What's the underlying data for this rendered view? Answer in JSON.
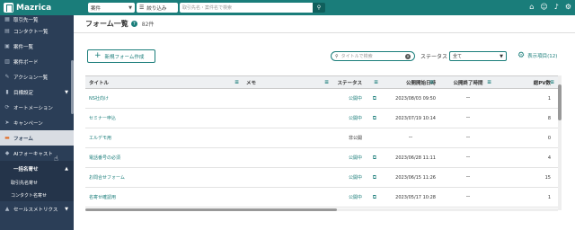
{
  "app": {
    "name": "Mazrica"
  },
  "topbar": {
    "search_type": "案件",
    "filter_label": "絞り込み",
    "search_placeholder": "取引先名・案件名で検索"
  },
  "sidebar": {
    "items": [
      {
        "label": "取引先一覧",
        "icon": "building-icon"
      },
      {
        "label": "コンタクト一覧",
        "icon": "contact-card-icon"
      },
      {
        "label": "案件一覧",
        "icon": "deal-list-icon"
      },
      {
        "label": "案件ボード",
        "icon": "board-icon"
      },
      {
        "label": "アクション一覧",
        "icon": "action-icon"
      },
      {
        "label": "目標設定",
        "icon": "target-icon"
      },
      {
        "label": "オートメーション",
        "icon": "automation-icon"
      },
      {
        "label": "キャンペーン",
        "icon": "megaphone-icon"
      },
      {
        "label": "フォーム",
        "icon": "form-icon"
      },
      {
        "label": "AIフォーキャスト",
        "icon": "ai-forecast-icon"
      }
    ],
    "group": {
      "label": "一括名寄せ"
    },
    "sub_items": [
      "取引先名寄せ",
      "コンタクト名寄せ"
    ],
    "bottom": {
      "label": "セールスメトリクス"
    }
  },
  "page": {
    "title": "フォーム一覧",
    "count": "82件",
    "new_button": "新規フォーム作成",
    "title_search_placeholder": "タイトルで検索",
    "status_label": "ステータス",
    "status_value": "全て",
    "display_items": "表示項目(12)"
  },
  "table": {
    "headers": [
      "タイトル",
      "メモ",
      "ステータス",
      "公開開始日時",
      "公開終了時間",
      "総PV数"
    ],
    "rows": [
      {
        "title": "NS社向け",
        "memo": "",
        "status": "公開中",
        "start": "2023/08/03 09:50",
        "end": "ー",
        "pv": "1"
      },
      {
        "title": "セミナー申込",
        "memo": "",
        "status": "公開中",
        "start": "2023/07/19 10:14",
        "end": "ー",
        "pv": "8"
      },
      {
        "title": "エルデモ用",
        "memo": "",
        "status": "非公開",
        "start": "ー",
        "end": "ー",
        "pv": "0"
      },
      {
        "title": "電話番号の必須",
        "memo": "",
        "status": "公開中",
        "start": "2023/06/28 11:11",
        "end": "ー",
        "pv": "4"
      },
      {
        "title": "お問合せフォーム",
        "memo": "",
        "status": "公開中",
        "start": "2023/06/15 11:26",
        "end": "ー",
        "pv": "15"
      },
      {
        "title": "名寄せ確認用",
        "memo": "",
        "status": "公開中",
        "start": "2023/05/17 10:28",
        "end": "ー",
        "pv": "1"
      }
    ]
  },
  "colors": {
    "brand": "#1a7d7a",
    "sidebar": "#2b3e57"
  }
}
